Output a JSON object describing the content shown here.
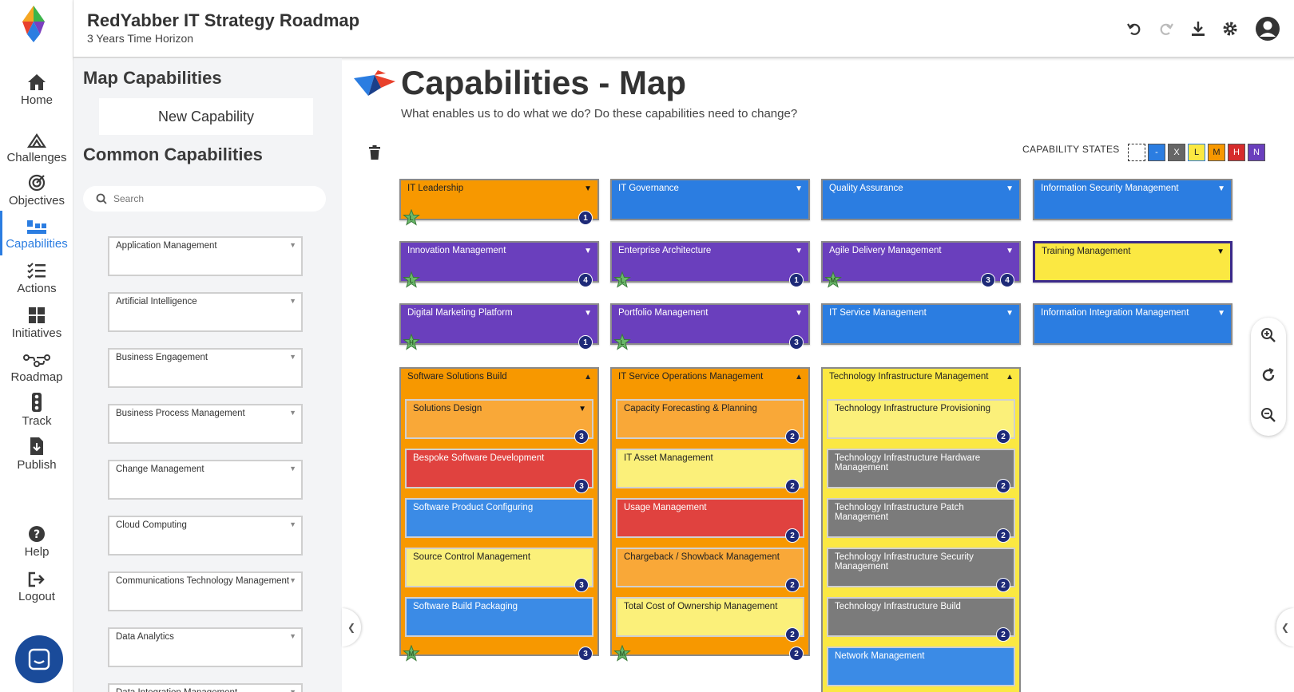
{
  "app": {
    "title": "RedYabber IT Strategy Roadmap",
    "subtitle": "3 Years Time Horizon"
  },
  "nav": {
    "items": [
      {
        "label": "Home",
        "icon": "home-icon"
      },
      {
        "label": "Challenges",
        "icon": "mountain-icon"
      },
      {
        "label": "Objectives",
        "icon": "target-icon"
      },
      {
        "label": "Capabilities",
        "icon": "capabilities-icon",
        "active": true
      },
      {
        "label": "Actions",
        "icon": "checklist-icon"
      },
      {
        "label": "Initiatives",
        "icon": "grid-icon"
      },
      {
        "label": "Roadmap",
        "icon": "roadmap-icon"
      },
      {
        "label": "Track",
        "icon": "traffic-light-icon"
      },
      {
        "label": "Publish",
        "icon": "document-download-icon"
      },
      {
        "label": "Help",
        "icon": "help-icon"
      },
      {
        "label": "Logout",
        "icon": "logout-icon"
      }
    ]
  },
  "panel": {
    "title": "Map Capabilities",
    "new_button": "New Capability",
    "common_title": "Common Capabilities",
    "search_placeholder": "Search",
    "common": [
      "Application Management",
      "Artificial Intelligence",
      "Business Engagement",
      "Business Process Management",
      "Change Management",
      "Cloud Computing",
      "Communications Technology Management",
      "Data Analytics",
      "Data Integration Management"
    ]
  },
  "main": {
    "title": "Capabilities - Map",
    "subtitle": "What enables us to do what we do? Do these capabilities need to change?",
    "states_label": "CAPABILITY STATES",
    "states": [
      {
        "label": "",
        "color": "#ffffff"
      },
      {
        "label": "-",
        "color": "#2b7de1"
      },
      {
        "label": "X",
        "color": "#666666"
      },
      {
        "label": "L",
        "color": "#fbe842"
      },
      {
        "label": "M",
        "color": "#f79800"
      },
      {
        "label": "H",
        "color": "#d62c2c"
      },
      {
        "label": "N",
        "color": "#6a3fbd"
      }
    ]
  },
  "capabilities": [
    {
      "name": "IT Leadership",
      "color": "orange",
      "star": "L",
      "count": "1"
    },
    {
      "name": "IT Governance",
      "color": "blue"
    },
    {
      "name": "Quality Assurance",
      "color": "blue"
    },
    {
      "name": "Information Security Management",
      "color": "blue"
    },
    {
      "name": "Innovation Management",
      "color": "purple",
      "star": "L",
      "count": "4"
    },
    {
      "name": "Enterprise Architecture",
      "color": "purple",
      "star": "L",
      "count": "1"
    },
    {
      "name": "Agile Delivery Management",
      "color": "purple",
      "star": "M",
      "count": "4",
      "count2": "3"
    },
    {
      "name": "Training Management",
      "color": "yellow"
    },
    {
      "name": "Digital Marketing Platform",
      "color": "purple",
      "star": "H",
      "count": "1"
    },
    {
      "name": "Portfolio Management",
      "color": "purple",
      "star": "L",
      "count": "3"
    },
    {
      "name": "IT Service Management",
      "color": "blue"
    },
    {
      "name": "Information Integration Management",
      "color": "blue"
    }
  ],
  "groups": [
    {
      "name": "Software Solutions Build",
      "star": "M",
      "count": "3",
      "children": [
        {
          "name": "Solutions Design",
          "color": "lorange",
          "count": "3",
          "arrow": true
        },
        {
          "name": "Bespoke Software Development",
          "color": "red",
          "count": "3"
        },
        {
          "name": "Software Product Configuring",
          "color": "lblue"
        },
        {
          "name": "Source Control Management",
          "color": "lyellow",
          "count": "3"
        },
        {
          "name": "Software Build Packaging",
          "color": "lblue"
        }
      ]
    },
    {
      "name": "IT Service Operations Management",
      "star": "M",
      "count": "2",
      "children": [
        {
          "name": "Capacity Forecasting & Planning",
          "color": "lorange",
          "count": "2"
        },
        {
          "name": "IT Asset Management",
          "color": "lyellow",
          "count": "2"
        },
        {
          "name": "Usage Management",
          "color": "red",
          "count": "2"
        },
        {
          "name": "Chargeback / Showback Management",
          "color": "lorange",
          "count": "2"
        },
        {
          "name": "Total Cost of Ownership Management",
          "color": "lyellow",
          "count": "2"
        }
      ]
    },
    {
      "name": "Technology Infrastructure Management",
      "children": [
        {
          "name": "Technology Infrastructure Provisioning",
          "color": "lyellow",
          "count": "2"
        },
        {
          "name": "Technology Infrastructure Hardware Management",
          "color": "gray",
          "count": "2"
        },
        {
          "name": "Technology Infrastructure Patch Management",
          "color": "gray",
          "count": "2"
        },
        {
          "name": "Technology Infrastructure Security Management",
          "color": "gray",
          "count": "2"
        },
        {
          "name": "Technology Infrastructure Build",
          "color": "gray",
          "count": "2"
        },
        {
          "name": "Network Management",
          "color": "lblue"
        }
      ]
    }
  ]
}
